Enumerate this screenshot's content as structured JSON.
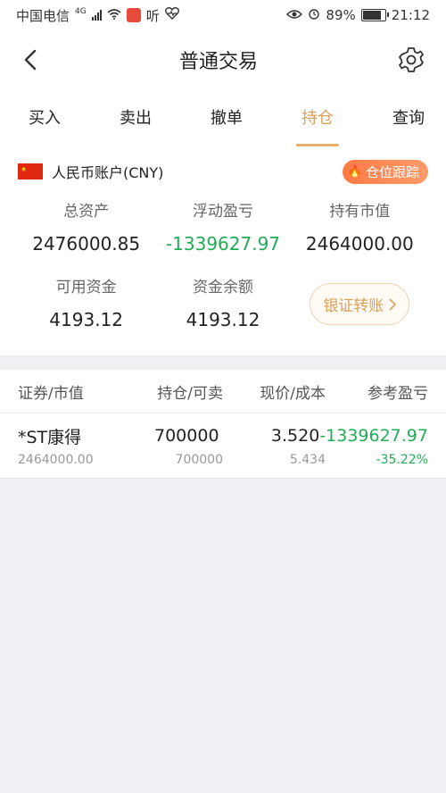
{
  "status_bar": {
    "carrier": "中国电信",
    "network": "4G",
    "listen_app": "听",
    "battery": "89%",
    "time": "21:12"
  },
  "header": {
    "title": "普通交易"
  },
  "tabs": [
    {
      "label": "买入"
    },
    {
      "label": "卖出"
    },
    {
      "label": "撤单"
    },
    {
      "label": "持仓"
    },
    {
      "label": "查询"
    }
  ],
  "account": {
    "name": "人民币账户(CNY)",
    "track_label": "仓位跟踪",
    "total_assets_label": "总资产",
    "total_assets": "2476000.85",
    "floating_pl_label": "浮动盈亏",
    "floating_pl": "-1339627.97",
    "market_value_label": "持有市值",
    "market_value": "2464000.00",
    "available_label": "可用资金",
    "available": "4193.12",
    "balance_label": "资金余额",
    "balance": "4193.12",
    "transfer_label": "银证转账"
  },
  "positions": {
    "headers": [
      "证券/市值",
      "持仓/可卖",
      "现价/成本",
      "参考盈亏"
    ],
    "rows": [
      {
        "name": "*ST康得",
        "market_value": "2464000.00",
        "holding": "700000",
        "sellable": "700000",
        "price": "3.520",
        "cost": "5.434",
        "pl": "-1339627.97",
        "pl_pct": "-35.22%"
      }
    ]
  },
  "colors": {
    "accent": "#d9a05b",
    "loss_green": "#1fad55",
    "track_orange": "#ff7a45"
  }
}
